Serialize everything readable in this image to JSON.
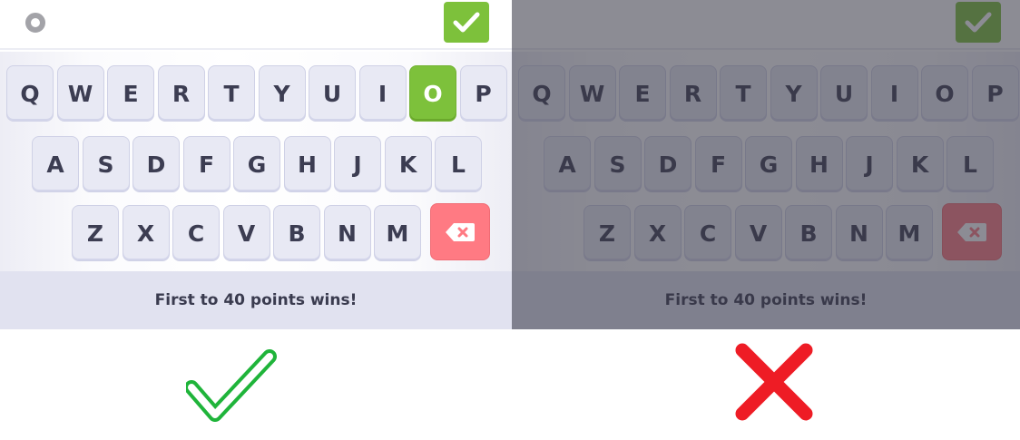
{
  "rows": [
    [
      "Q",
      "W",
      "E",
      "R",
      "T",
      "Y",
      "U",
      "I",
      "O",
      "P"
    ],
    [
      "A",
      "S",
      "D",
      "F",
      "G",
      "H",
      "J",
      "K",
      "L"
    ],
    [
      "Z",
      "X",
      "C",
      "V",
      "B",
      "N",
      "M"
    ]
  ],
  "panels": [
    {
      "id": "left",
      "state": "correct",
      "selected_key": "O",
      "footer_text": "First to 40 points wins!",
      "dimmed": false
    },
    {
      "id": "right",
      "state": "incorrect",
      "selected_key": "",
      "footer_text": "First to 40 points wins!",
      "dimmed": true
    }
  ],
  "icons": {
    "settings": "settings-circle-icon",
    "confirm": "checkmark-icon",
    "delete": "backspace-icon",
    "verdict_good": "green-checkmark-icon",
    "verdict_bad": "red-x-icon"
  },
  "colors": {
    "accent_green": "#7dc13b",
    "delete_red": "#ff7a83",
    "key_bg": "#e8e9f4",
    "footer_bg": "#e1e2f0",
    "verdict_green": "#1fb43a",
    "verdict_red": "#ee1c25"
  }
}
